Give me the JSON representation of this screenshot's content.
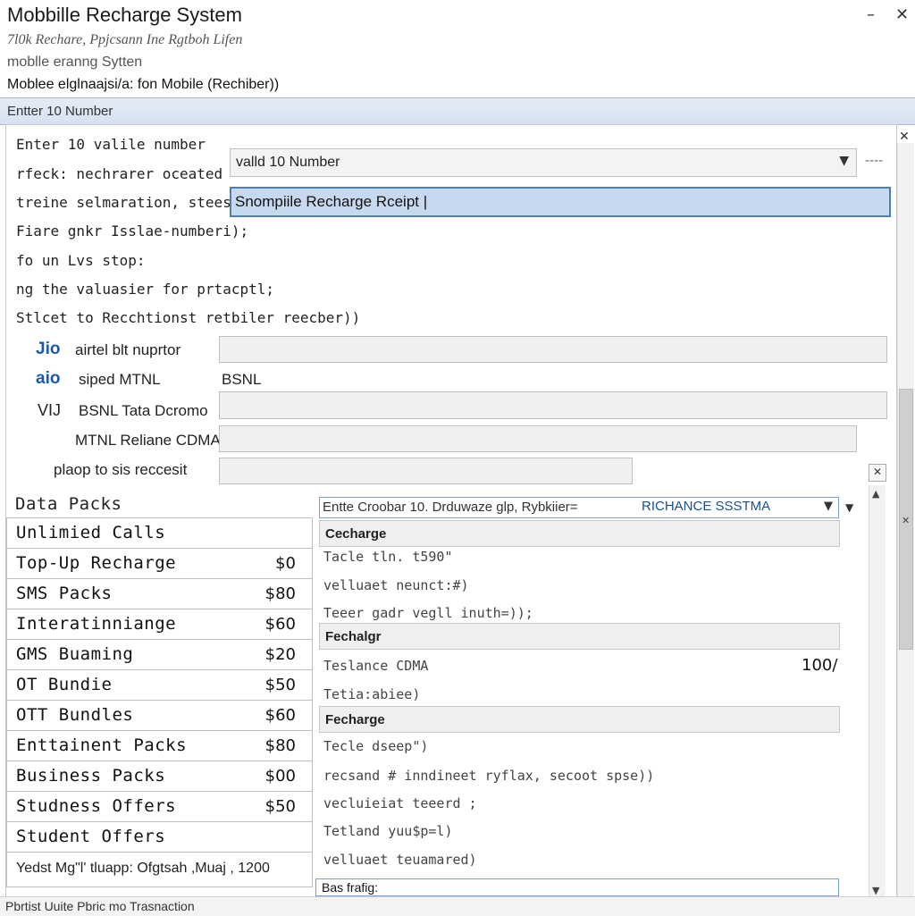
{
  "window": {
    "title": "Mobbille Recharge System",
    "minimize": "–",
    "close": "✕"
  },
  "header": {
    "line1": "7l0k Rechare, Ppjcsann Ine Rgtboh Lifen",
    "line2": "moblle eranng Sytten",
    "line3": "Moblee elglnaajsi/a: fon Mobile (Rechiber))"
  },
  "band": {
    "label": "Entter 10 Number"
  },
  "form": {
    "lines": [
      "Enter  10 valile number",
      "rfeck: nechrarer oceated",
      "treine selmaration, steesl",
      "Fiare gnkr Isslae-numberi);",
      "fo un Lvs stop:",
      "ng the valuasier for prtacptl;",
      "Stlcet to Recchtionst retbiler reecber))"
    ],
    "number_dropdown": "valld 10 Number",
    "number_dash": "----",
    "selected_field": "Snompiile Recharge Rceipt |"
  },
  "operators": {
    "row1": {
      "brand": "Jio",
      "label": "airtel blt nuprtor"
    },
    "row2": {
      "brand": "aio",
      "label": "siped MTNL",
      "extra": "BSNL"
    },
    "row3": {
      "brand": "VIJ",
      "label": "BSNL  Tata Dcromo"
    },
    "row4": {
      "label": "MTNL  Reliane CDMA"
    },
    "row5": {
      "label": "plaop to sis reccesit"
    }
  },
  "plans": {
    "heading": "Data Packs",
    "items": [
      {
        "name": "Unlimied Calls",
        "price": ""
      },
      {
        "name": "Top-Up Recharge",
        "price": "$0"
      },
      {
        "name": "SMS Packs",
        "price": "$80"
      },
      {
        "name": "Interatinniange",
        "price": "$60"
      },
      {
        "name": "GMS Buaming",
        "price": "$20"
      },
      {
        "name": "OT Bundie",
        "price": "$50"
      },
      {
        "name": "OTT  Bundles",
        "price": "$60"
      },
      {
        "name": "Enttainent Packs",
        "price": "$80"
      },
      {
        "name": "Business Packs",
        "price": "$00"
      },
      {
        "name": "Studness Offers",
        "price": "$50"
      },
      {
        "name": "Student Offers",
        "price": ""
      }
    ],
    "footer": "Yedst Mg\"l' tluapp: Ofgtsah ,Muaj , 1200"
  },
  "receipt": {
    "header_text": "Entte Croobar 10. Drduwaze glp, Rybkiier=",
    "header_accent": "RICHANCE  SSSTMA",
    "sections": [
      {
        "title": "Cecharge",
        "lines": [
          "Tacle tln. t590\"",
          "velluaet neunct:#)",
          "Teeer gadr vegll inuth=));"
        ]
      },
      {
        "title": "Fechalgr",
        "lines": [
          "Teslance  CDMA",
          "Tetia:abiee)"
        ],
        "value": "100/"
      },
      {
        "title": "Fecharge",
        "lines": [
          "Tecle dseep\")",
          "recsand # inndineet ryflax, secoot spse))",
          "vecluieiat teeerd ;",
          "Tetland yuu$p=l)",
          "velluaet teuamared)"
        ]
      },
      {
        "title": "Bas frafig:"
      }
    ]
  },
  "status": {
    "text": "Pbrtist Uuite Pbric mo Trasnaction"
  },
  "colors": {
    "accent": "#4e7eb8",
    "selected_bg": "#c7d9ee",
    "brand_blue": "#1c5aa6"
  }
}
